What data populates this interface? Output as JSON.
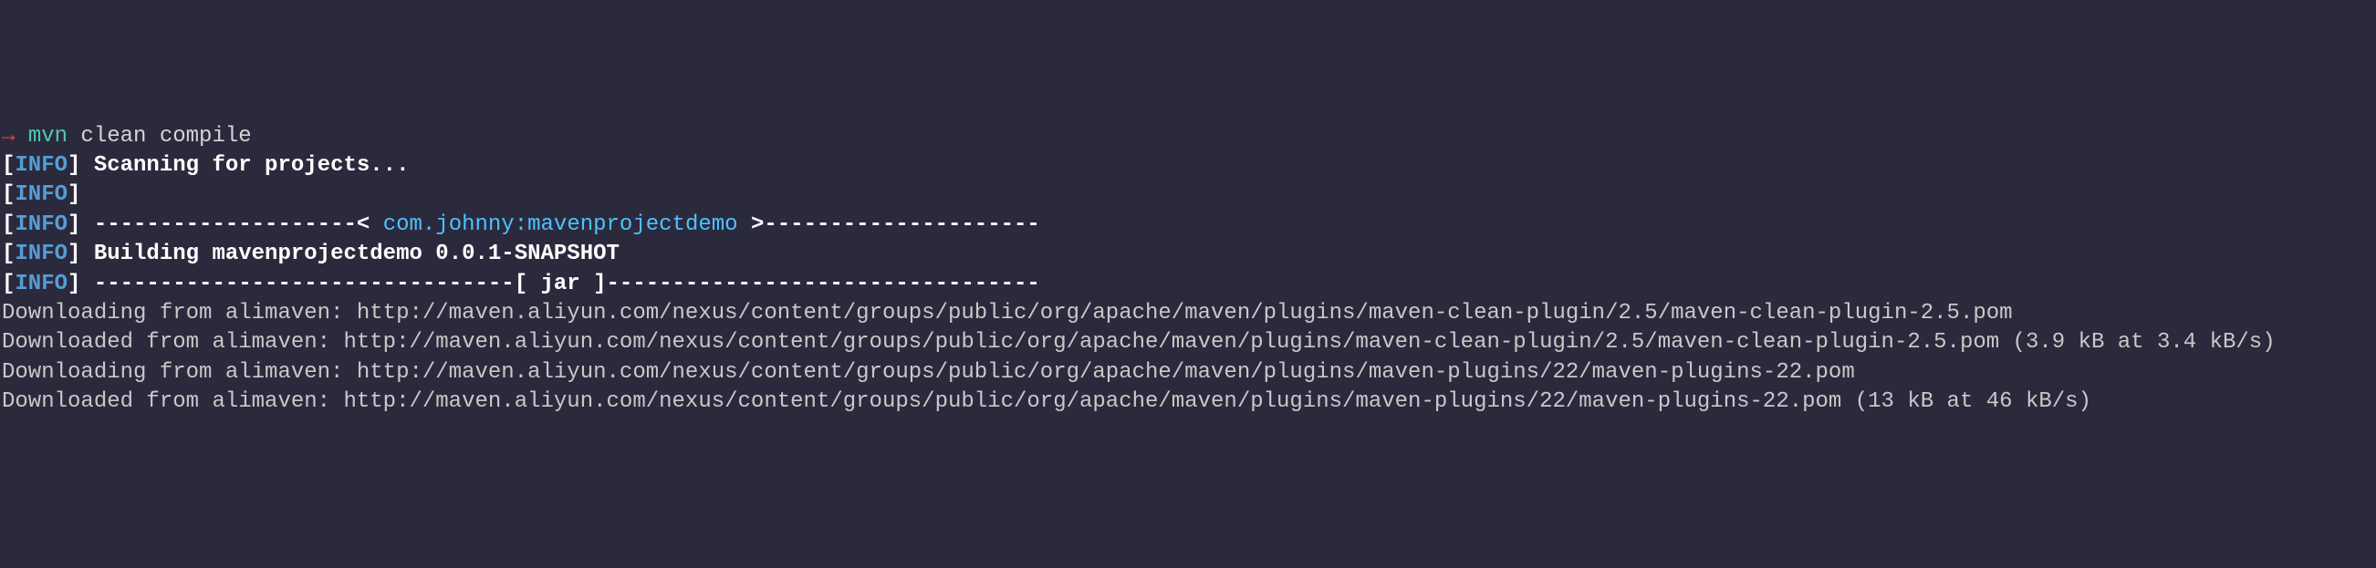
{
  "prompt": {
    "arrow": "→",
    "command": "mvn",
    "args": " clean compile"
  },
  "lines": {
    "scanning": " Scanning for projects...",
    "blank": "",
    "sep_left": " --------------------< ",
    "project_id": "com.johnny:mavenprojectdemo",
    "sep_right": " >---------------------",
    "building": " Building mavenprojectdemo 0.0.1-SNAPSHOT",
    "jar_line": " --------------------------------[ jar ]---------------------------------",
    "dl1": "Downloading from alimaven: http://maven.aliyun.com/nexus/content/groups/public/org/apache/maven/plugins/maven-clean-plugin/2.5/maven-clean-plugin-2.5.pom",
    "dl2": "Downloaded from alimaven: http://maven.aliyun.com/nexus/content/groups/public/org/apache/maven/plugins/maven-clean-plugin/2.5/maven-clean-plugin-2.5.pom (3.9 kB at 3.4 kB/s)",
    "dl3": "Downloading from alimaven: http://maven.aliyun.com/nexus/content/groups/public/org/apache/maven/plugins/maven-plugins/22/maven-plugins-22.pom",
    "dl4": "Downloaded from alimaven: http://maven.aliyun.com/nexus/content/groups/public/org/apache/maven/plugins/maven-plugins/22/maven-plugins-22.pom (13 kB at 46 kB/s)"
  },
  "tags": {
    "open": "[",
    "info": "INFO",
    "close": "]"
  }
}
